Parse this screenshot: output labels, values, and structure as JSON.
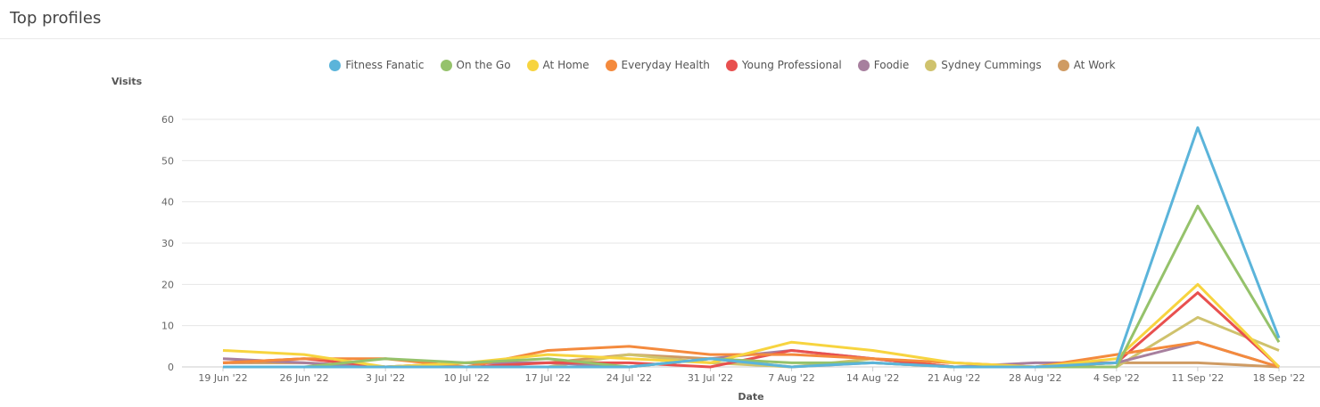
{
  "header": {
    "title": "Top profiles"
  },
  "chart_data": {
    "type": "line",
    "title": "",
    "xlabel": "Date",
    "ylabel": "Visits",
    "ylim": [
      0,
      60
    ],
    "yticks": [
      0,
      10,
      20,
      30,
      40,
      50,
      60
    ],
    "grid": "horizontal",
    "legend_position": "top",
    "categories": [
      "19 Jun '22",
      "26 Jun '22",
      "3 Jul '22",
      "10 Jul '22",
      "17 Jul '22",
      "24 Jul '22",
      "31 Jul '22",
      "7 Aug '22",
      "14 Aug '22",
      "21 Aug '22",
      "28 Aug '22",
      "4 Sep '22",
      "11 Sep '22",
      "18 Sep '22"
    ],
    "series": [
      {
        "name": "Fitness Fanatic",
        "color": "#5bb4da",
        "values": [
          0,
          0,
          0,
          0,
          0,
          0,
          2,
          0,
          1,
          0,
          0,
          1,
          58,
          7
        ]
      },
      {
        "name": "On the Go",
        "color": "#95c26b",
        "values": [
          0,
          0,
          2,
          1,
          2,
          0,
          2,
          1,
          1,
          0,
          0,
          0,
          39,
          6
        ]
      },
      {
        "name": "At Home",
        "color": "#f7d43f",
        "values": [
          4,
          3,
          0,
          1,
          3,
          2,
          1,
          6,
          4,
          1,
          0,
          2,
          20,
          0
        ]
      },
      {
        "name": "Everyday Health",
        "color": "#f48a3d",
        "values": [
          1,
          2,
          2,
          0,
          4,
          5,
          3,
          3,
          2,
          1,
          0,
          3,
          6,
          0
        ]
      },
      {
        "name": "Young Professional",
        "color": "#e8504f",
        "values": [
          1,
          2,
          0,
          0,
          1,
          1,
          0,
          4,
          2,
          0,
          0,
          1,
          18,
          0
        ]
      },
      {
        "name": "Foodie",
        "color": "#a77f9e",
        "values": [
          2,
          1,
          0,
          1,
          1,
          0,
          2,
          4,
          2,
          0,
          1,
          1,
          6,
          0
        ]
      },
      {
        "name": "Sydney Cummings",
        "color": "#cfc26d",
        "values": [
          0,
          0,
          0,
          0,
          0,
          3,
          1,
          0,
          2,
          0,
          0,
          0,
          12,
          4
        ]
      },
      {
        "name": "At Work",
        "color": "#cf9b63",
        "values": [
          1,
          1,
          0,
          1,
          1,
          3,
          2,
          0,
          1,
          0,
          0,
          1,
          1,
          0
        ]
      }
    ]
  }
}
